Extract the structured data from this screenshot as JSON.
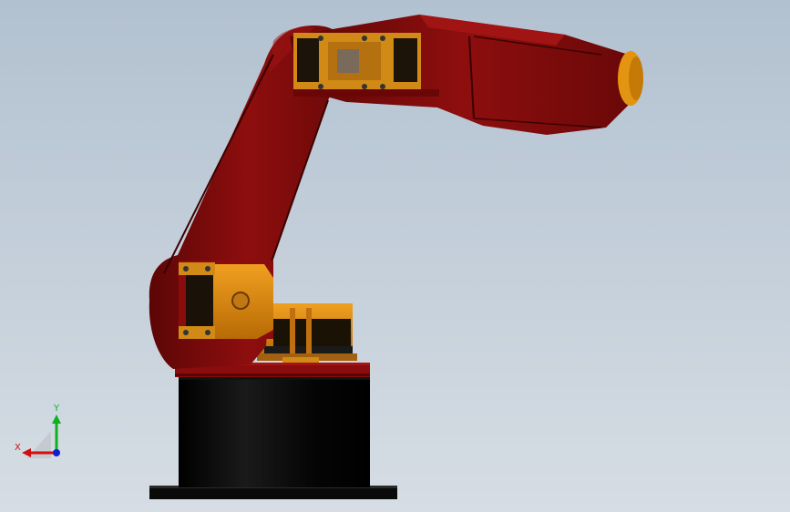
{
  "view": {
    "background_top": "#b2c1d0",
    "background_bottom": "#d6dde4"
  },
  "model": {
    "body_color": "#820a0a",
    "motor_color": "#e8960e",
    "base_color": "#050505"
  },
  "triad": {
    "x_label": "X",
    "y_label": "Y",
    "x_color": "#d01010",
    "y_color": "#10b020",
    "z_color": "#1020d0"
  }
}
